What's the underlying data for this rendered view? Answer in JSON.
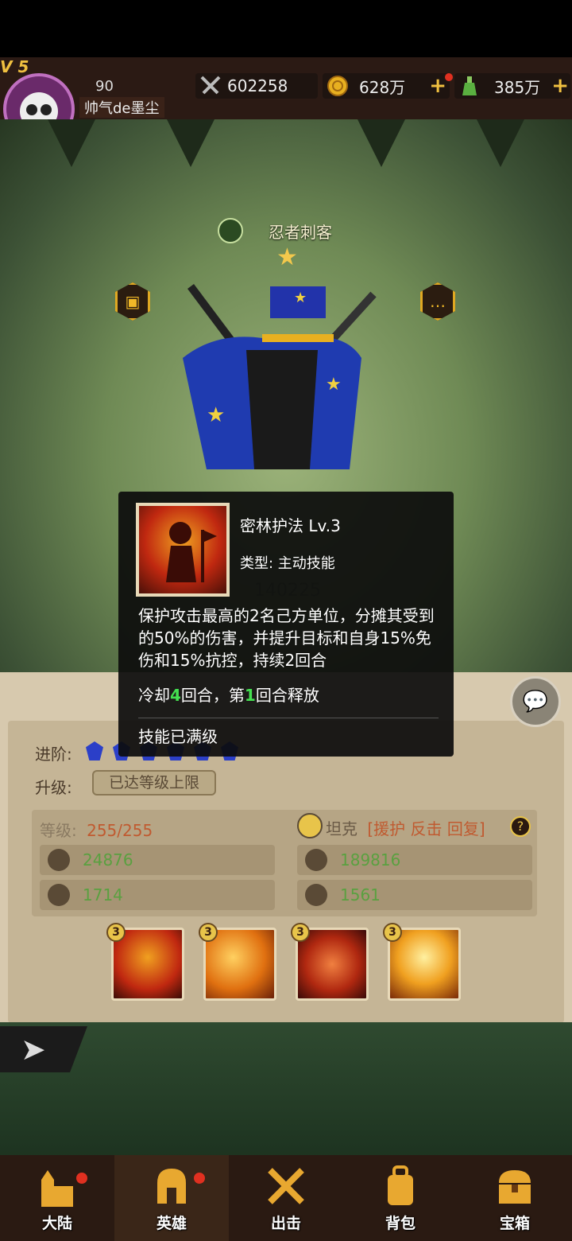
{
  "player": {
    "vip": "V 5",
    "level": "90",
    "name": "帅气de墨尘"
  },
  "resources": [
    {
      "icon": "crossed-swords-icon",
      "value": "602258",
      "has_plus": false
    },
    {
      "icon": "gold-coin-icon",
      "value": "628万",
      "has_plus": true
    },
    {
      "icon": "potion-bottle-icon",
      "value": "385万",
      "has_plus": true
    }
  ],
  "hero": {
    "name": "忍者刺客",
    "stars": "★",
    "power_faded": "140225"
  },
  "tooltip": {
    "title": "密林护法  Lv.3",
    "type": "类型: 主动技能",
    "description": "保护攻击最高的2名己方单位，分摊其受到的50%的伤害，并提升目标和自身15%免伤和15%抗控，持续2回合",
    "cooldown_prefix": "冷却",
    "cooldown_turns": "4",
    "cooldown_mid": "回合，第",
    "release_turn": "1",
    "cooldown_suffix": "回合释放",
    "max_text": "技能已满级"
  },
  "panel": {
    "advance_label": "进阶:",
    "upgrade_label": "升级:",
    "upgrade_button": "已达等级上限",
    "level_label": "等级:",
    "level_value": "255/255",
    "class_name": "坦克",
    "class_tags": "[援护 反击 回复]",
    "stats": {
      "attack": "24876",
      "hp": "189816",
      "defense": "1714",
      "speed": "1561"
    }
  },
  "skills": [
    {
      "level": "3",
      "name": "密林护法"
    },
    {
      "level": "3",
      "name": "skill-2"
    },
    {
      "level": "3",
      "name": "skill-3"
    },
    {
      "level": "3",
      "name": "skill-4"
    }
  ],
  "nav": [
    {
      "label": "大陆",
      "icon": "castle-icon",
      "badge": true
    },
    {
      "label": "英雄",
      "icon": "helmet-icon",
      "badge": true
    },
    {
      "label": "出击",
      "icon": "crossed-swords-icon",
      "badge": false
    },
    {
      "label": "背包",
      "icon": "backpack-icon",
      "badge": false
    },
    {
      "label": "宝箱",
      "icon": "treasure-chest-icon",
      "badge": false
    }
  ],
  "colors": {
    "gold": "#f0c040",
    "highlight_green": "#44e050",
    "stat_green": "#5aa040",
    "nav_bg": "#2a1a12"
  }
}
